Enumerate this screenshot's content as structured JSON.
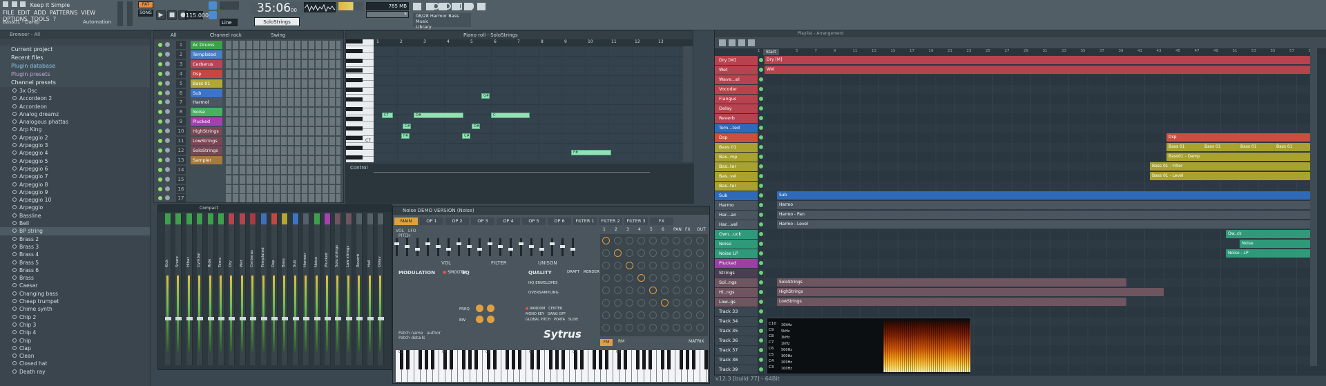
{
  "window": {
    "title": "Keep it Simple",
    "active_pattern": "Bass01 - Damp"
  },
  "menu": [
    "FILE",
    "EDIT",
    "ADD",
    "PATTERNS",
    "VIEW",
    "OPTIONS",
    "TOOLS",
    "?"
  ],
  "transport": {
    "pattern_label": "PAT",
    "song_label": "SONG",
    "tempo": "115.000",
    "time": "35:06",
    "time_suffix": "00",
    "mode": "Line",
    "instrument": "SoloStrings",
    "cpu": "785 MB",
    "cpu2": "5",
    "news_date": "08/28",
    "news_text": "Harmor Bass Music",
    "news_sub": "Library",
    "automation_label": "Automation"
  },
  "browser": {
    "title": "Browser - All",
    "sections": [
      "Current project",
      "Recent files",
      "Plugin database",
      "Plugin presets",
      "Channel presets"
    ],
    "items": [
      "3x Osc",
      "Accordeon 2",
      "Accordeon",
      "Analog dreamz",
      "Analogous phattas",
      "Arp King",
      "Arpeggio 2",
      "Arpeggio 3",
      "Arpeggio 4",
      "Arpeggio 5",
      "Arpeggio 6",
      "Arpeggio 7",
      "Arpeggio 8",
      "Arpeggio 9",
      "Arpeggio 10",
      "Arpeggio",
      "Bassline",
      "Bell",
      "BP string",
      "Brass 2",
      "Brass 3",
      "Brass 4",
      "Brass 5",
      "Brass 6",
      "Brass",
      "Caesar",
      "Changing bass",
      "Cheap trumpet",
      "Chime synth",
      "Chip 2",
      "Chip 3",
      "Chip 4",
      "Chip",
      "Clap",
      "Clean",
      "Closed hat",
      "Death ray"
    ]
  },
  "channel_rack": {
    "title": "Channel rack",
    "filter": "All",
    "swing_label": "Swing",
    "channels": [
      {
        "num": "1",
        "name": "Ac Drums",
        "color": "#3fa04a"
      },
      {
        "num": "",
        "name": "Templated",
        "color": "#4a7fc7"
      },
      {
        "num": "",
        "name": "Cerberus",
        "color": "#b94455"
      },
      {
        "num": "",
        "name": "Dsp",
        "color": "#c5473f"
      },
      {
        "num": "",
        "name": "Bass 01",
        "color": "#b0a832"
      },
      {
        "num": "",
        "name": "Sub",
        "color": "#3c74c8"
      },
      {
        "num": "",
        "name": "Harmol",
        "color": "#4b5661"
      },
      {
        "num": "",
        "name": "Noise",
        "color": "#48b060"
      },
      {
        "num": "",
        "name": "Plucked",
        "color": "#a83fb0"
      },
      {
        "num": "",
        "name": "HighStrings",
        "color": "#7a4753"
      },
      {
        "num": "",
        "name": "LowStrings",
        "color": "#7a4753"
      },
      {
        "num": "",
        "name": "SoloStrings",
        "color": "#7a4753"
      },
      {
        "num": "",
        "name": "Sampler",
        "color": "#a57a3d"
      }
    ],
    "row_numbers": [
      "1",
      "2",
      "3",
      "4",
      "5",
      "6",
      "7",
      "8",
      "9",
      "10",
      "11",
      "12",
      "13",
      "14",
      "15",
      "16",
      "17"
    ]
  },
  "piano_roll": {
    "title": "Piano roll - SoloStrings",
    "bars": [
      "1",
      "2",
      "3",
      "4",
      "5",
      "6",
      "7",
      "8",
      "9",
      "10",
      "11",
      "12",
      "13"
    ],
    "note_labels": [
      "C7",
      "C#",
      "D#",
      "F#",
      "C#",
      "D#",
      "G#",
      "C",
      "F#",
      "F#"
    ],
    "control_label": "Control",
    "key_label": "C7"
  },
  "mixer": {
    "title": "Compact",
    "inserts": [
      "Kick",
      "Snare",
      "Hihat",
      "Cymbal",
      "Ride",
      "Toms",
      "Dry",
      "Wet",
      "Cerberus",
      "Templated",
      "Dsp",
      "Bass",
      "Sub",
      "Harmor",
      "Noise",
      "Plucked",
      "Solo strings",
      "Low strings",
      "Reverb",
      "Hall",
      "Delay"
    ]
  },
  "sytrus": {
    "title": "Noise DEMO VERSION (Noise)",
    "tabs": [
      "MAIN",
      "OP 1",
      "OP 2",
      "OP 3",
      "OP 4",
      "OP 5",
      "OP 6",
      "FILTER 1",
      "FILTER 2",
      "FILTER 3",
      "FX"
    ],
    "matrix_cols": [
      "1",
      "2",
      "3",
      "4",
      "5",
      "6",
      "PAN",
      "FX",
      "OUT"
    ],
    "labels": {
      "modulation": "MODULATION",
      "vol": "VOL",
      "filter": "FILTER",
      "unison": "UNISON",
      "eq": "EQ",
      "quality": "QUALITY",
      "smooth": "SMOOTH",
      "hq_envelopes": "HQ ENVELOPES",
      "oversampling": "OVERSAMPLING",
      "draft": "DRAFT",
      "render": "RENDER",
      "freq": "FREQ",
      "bw": "BW",
      "patch_name": "Patch name",
      "patch_details": "Patch details",
      "author": "author",
      "logo": "Sytrus",
      "fm": "FM",
      "rm": "RM",
      "matrix": "MATRIX",
      "monokey": "MONO KEY",
      "global_pitch": "GLOBAL PITCH",
      "center": "CENTER",
      "gang_off": "GANG OFF",
      "porta": "PORTA",
      "slide": "SLIDE",
      "random": "RANDOM",
      "vol_knob": "VOL",
      "lfo": "LFO",
      "pitch": "PITCH"
    },
    "keyboard_octaves": [
      "C3",
      "C4",
      "C5",
      "C6",
      "C7",
      "C8"
    ]
  },
  "playlist": {
    "title": "Playlist - Arrangement",
    "start_marker": "Start",
    "ruler": [
      "1",
      "3",
      "5",
      "7",
      "9",
      "11",
      "13",
      "15",
      "17",
      "19",
      "21",
      "23",
      "25",
      "27",
      "29",
      "31",
      "33",
      "35",
      "37",
      "39",
      "41",
      "43",
      "45",
      "47",
      "49",
      "51",
      "53",
      "55",
      "57",
      "59"
    ],
    "tracks": [
      {
        "name": "Dry [M]",
        "color": "#b8424e"
      },
      {
        "name": "Wet",
        "color": "#b8424e"
      },
      {
        "name": "Wave...el",
        "color": "#b8424e"
      },
      {
        "name": "Vocoder",
        "color": "#b8424e"
      },
      {
        "name": "Flangus",
        "color": "#b8424e"
      },
      {
        "name": "Delay",
        "color": "#b8424e"
      },
      {
        "name": "Reverb",
        "color": "#b8424e"
      },
      {
        "name": "Tem...ted",
        "color": "#2f6ab8"
      },
      {
        "name": "Dsp",
        "color": "#c8503c"
      },
      {
        "name": "Bass 01",
        "color": "#a9a130"
      },
      {
        "name": "Bas..mp",
        "color": "#a9a130"
      },
      {
        "name": "Bas..ter",
        "color": "#a9a130"
      },
      {
        "name": "Bas..vel",
        "color": "#a9a130"
      },
      {
        "name": "Bas..ter",
        "color": "#a9a130"
      },
      {
        "name": "Sub",
        "color": "#2f6ab8"
      },
      {
        "name": "Harmo",
        "color": "#4a5560"
      },
      {
        "name": "Har...an",
        "color": "#4a5560"
      },
      {
        "name": "Har...vel",
        "color": "#4a5560"
      },
      {
        "name": "Own...uck",
        "color": "#2f9a7a"
      },
      {
        "name": "Noise",
        "color": "#2f9a7a"
      },
      {
        "name": "Noise LP",
        "color": "#2f9a7a"
      },
      {
        "name": "Plucked",
        "color": "#9a3fa5"
      },
      {
        "name": "Strings",
        "color": "#4a3f52"
      },
      {
        "name": "Sol..ngs",
        "color": "#6e5560"
      },
      {
        "name": "Hi..ngs",
        "color": "#6e5560"
      },
      {
        "name": "Low..gs",
        "color": "#6e5560"
      },
      {
        "name": "Track 33",
        "color": "#3a4650"
      },
      {
        "name": "Track 34",
        "color": "#3a4650"
      },
      {
        "name": "Track 35",
        "color": "#3a4650"
      },
      {
        "name": "Track 36",
        "color": "#3a4650"
      },
      {
        "name": "Track 37",
        "color": "#3a4650"
      },
      {
        "name": "Track 38",
        "color": "#3a4650"
      },
      {
        "name": "Track 39",
        "color": "#3a4650"
      }
    ],
    "clips": {
      "dry": "Dry [M]",
      "wet": "Wet",
      "dsp": "Dsp",
      "bass01": "Bass 01",
      "bass_damp": "Bass01 - Damp",
      "bass_filter": "Bass 01 - Filter",
      "bass_level": "Bass 01 - Level",
      "sub": "Sub",
      "harmo": "Harmo",
      "harmo_pan": "Harmo - Pan",
      "harmo_level": "Harmo - Level",
      "ownpluck": "Ow..ck",
      "noise": "Noise",
      "noise_lp": "Noise - LP",
      "solostrings": "SoloStrings",
      "highstrings": "HighStrings",
      "lowstrings": "LowStrings"
    }
  },
  "spectrogram": {
    "notes": [
      "C10",
      "C9",
      "C8",
      "C7",
      "C6",
      "C5",
      "C4",
      "C3"
    ],
    "freqs": [
      "10kHz",
      "5kHz",
      "3kHz",
      "1kHz",
      "500Hz",
      "300Hz",
      "200Hz",
      "100Hz"
    ]
  },
  "status": {
    "version": "v12.3 [build 77] - 64Bit"
  }
}
